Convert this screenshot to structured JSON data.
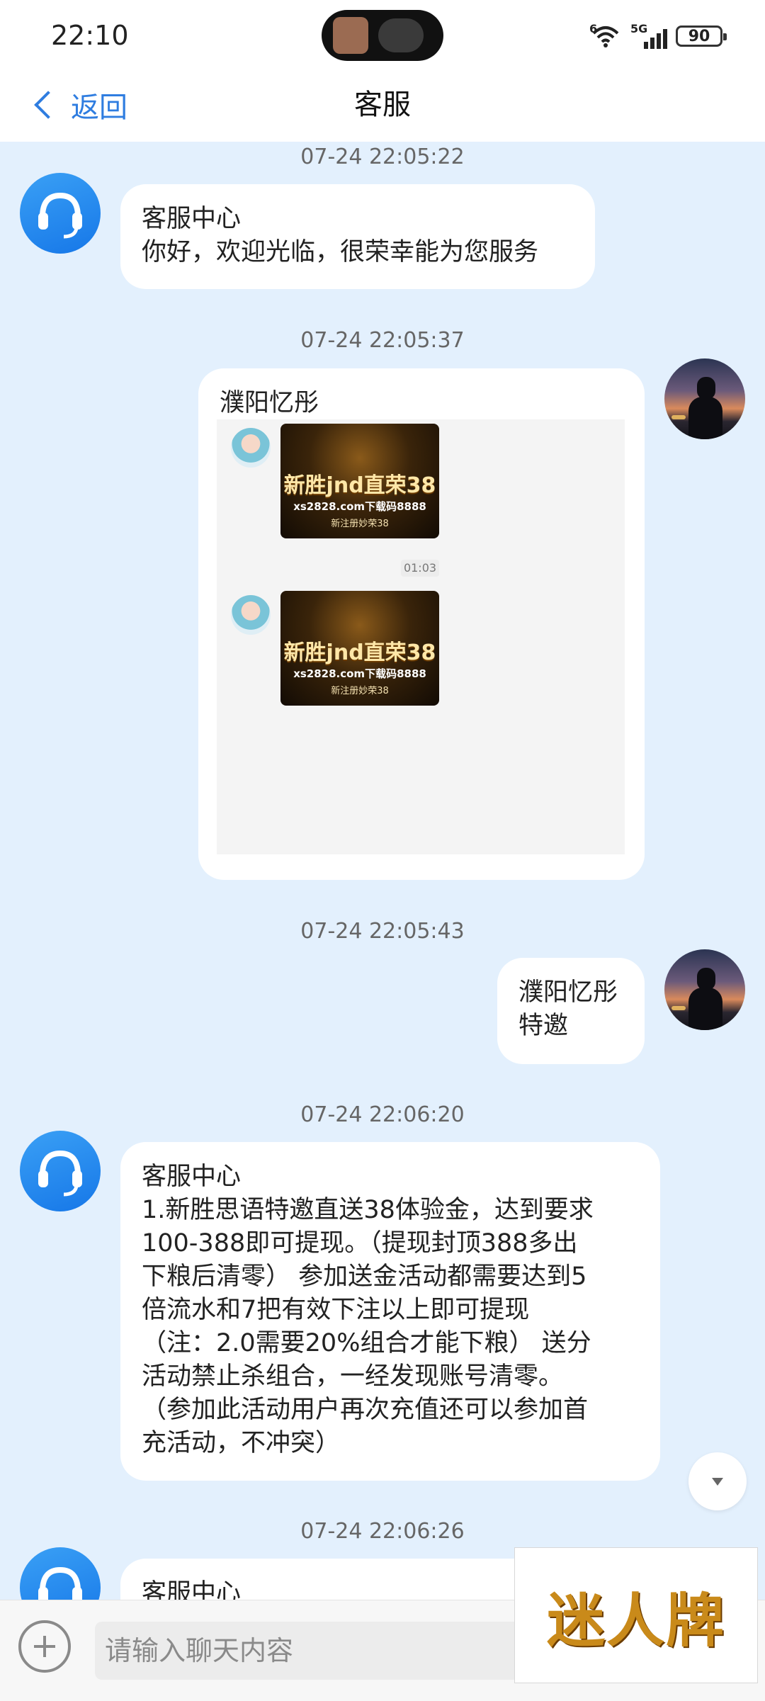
{
  "status_bar": {
    "time": "22:10",
    "wifi_label": "6",
    "signal_label": "5G",
    "battery": "90"
  },
  "header": {
    "back_label": "返回",
    "title": "客服"
  },
  "messages": [
    {
      "time": "07-24 22:05:22",
      "sender": "客服中心",
      "lines": [
        "你好，欢迎光临，很荣幸能为您服务"
      ]
    },
    {
      "time": "07-24 22:05:37",
      "sender": "濮阳忆彤",
      "shared": {
        "mini_time": "01:03",
        "promo_title": "新胜jnd直荣38",
        "promo_sub": "xs2828.com下载码8888",
        "promo_sub2": "新注册妙荣38"
      }
    },
    {
      "time": "07-24 22:05:43",
      "lines": [
        "濮阳忆彤",
        "特邀"
      ]
    },
    {
      "time": "07-24 22:06:20",
      "sender": "客服中心",
      "lines": [
        "1.新胜思语特邀直送38体验金，达到要求",
        "100-388即可提现。（提现封顶388多出",
        "下粮后清零） 参加送金活动都需要达到5",
        "倍流水和7把有效下注以上即可提现",
        "（注：2.0需要20%组合才能下粮） 送分",
        "活动禁止杀组合，一经发现账号清零。",
        "（参加此活动用户再次充值还可以参加首",
        "充活动，不冲突）"
      ]
    },
    {
      "time": "07-24 22:06:26",
      "sender": "客服中心"
    }
  ],
  "input": {
    "placeholder": "请输入聊天内容"
  },
  "watermark": "迷人牌",
  "icons": [
    "headset-icon",
    "wifi-icon",
    "signal-icon",
    "battery-icon",
    "chevron-left-icon",
    "plus-icon",
    "chevron-down-icon"
  ],
  "colors": {
    "accent": "#2f7de0",
    "chat_bg": "#e3f0fd",
    "bubble": "#ffffff"
  }
}
